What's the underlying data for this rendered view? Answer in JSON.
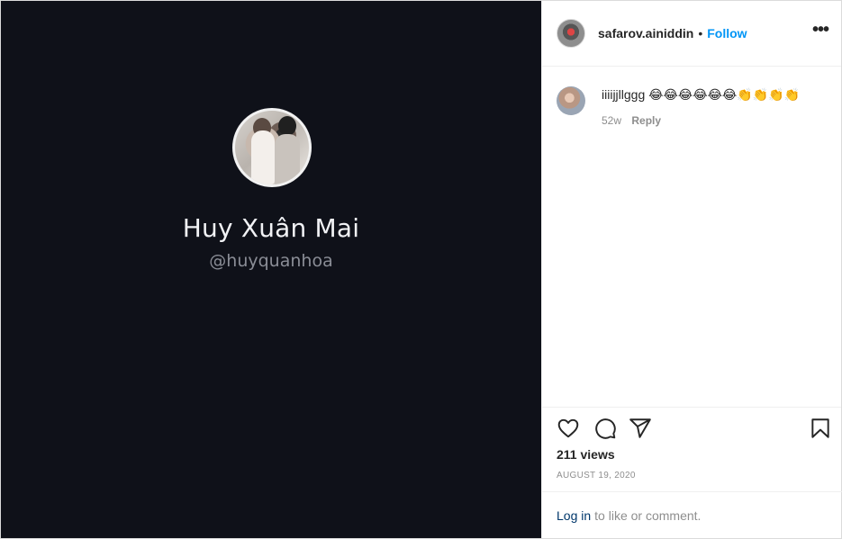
{
  "media": {
    "display_name": "Huy Xuân Mai",
    "handle": "@huyquanhoa",
    "avatar_icon": "profile-photo"
  },
  "header": {
    "username": "safarov.ainiddin",
    "separator": "•",
    "follow_label": "Follow",
    "more_icon": "•••"
  },
  "comments": [
    {
      "text": "iiiijjllggg 😂😂😂😂😂😂👏👏👏👏",
      "time": "52w",
      "reply_label": "Reply"
    }
  ],
  "actions": {
    "icons": [
      "heart-icon",
      "comment-icon",
      "share-icon",
      "bookmark-icon"
    ],
    "views": "211 views",
    "date": "AUGUST 19, 2020"
  },
  "login": {
    "link_label": "Log in",
    "rest_text": "to like or comment."
  },
  "colors": {
    "media_bg": "#0f1119",
    "follow": "#0095f6",
    "link": "#00376b"
  }
}
